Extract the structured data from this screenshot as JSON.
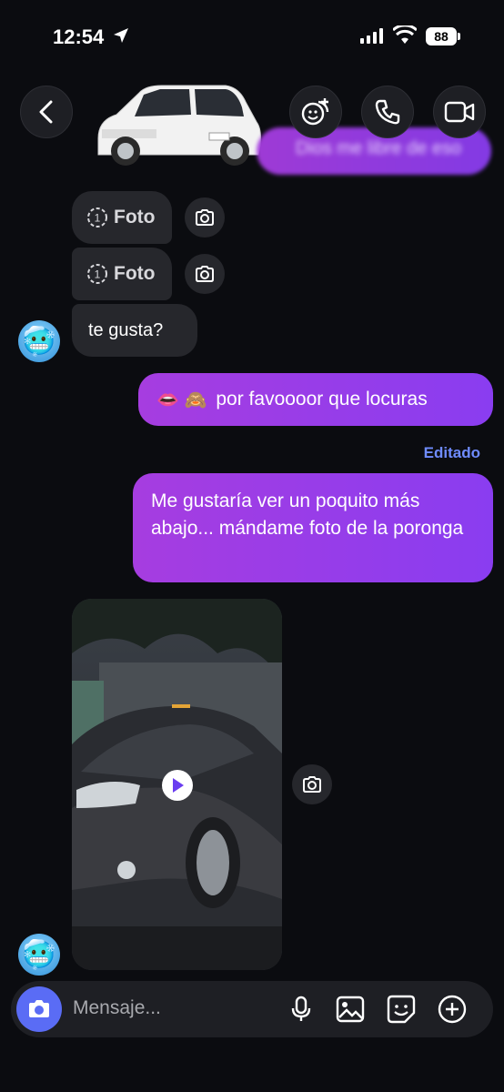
{
  "status_bar": {
    "time": "12:54",
    "battery": "88"
  },
  "header": {
    "blurred_message": "Dios me libre de eso"
  },
  "messages": {
    "foto_1": "Foto",
    "foto_2": "Foto",
    "foto_count": "1",
    "in_text": "te gusta?",
    "out_1_emoji": "👄 🙈",
    "out_1_text": "por favoooor que locuras",
    "edited_label": "Editado",
    "out_2_text": "Me gustaría ver un poquito más abajo... mándame foto de la poronga"
  },
  "composer": {
    "placeholder": "Mensaje..."
  },
  "colors": {
    "accent_purple": "#9b3df0",
    "edited_blue": "#6f8cff",
    "camera_blue": "#5a6cf5"
  },
  "icons": [
    "back-chevron-icon",
    "add-people-icon",
    "phone-icon",
    "video-icon",
    "camera-icon",
    "play-icon",
    "microphone-icon",
    "gallery-icon",
    "sticker-icon",
    "plus-icon"
  ]
}
